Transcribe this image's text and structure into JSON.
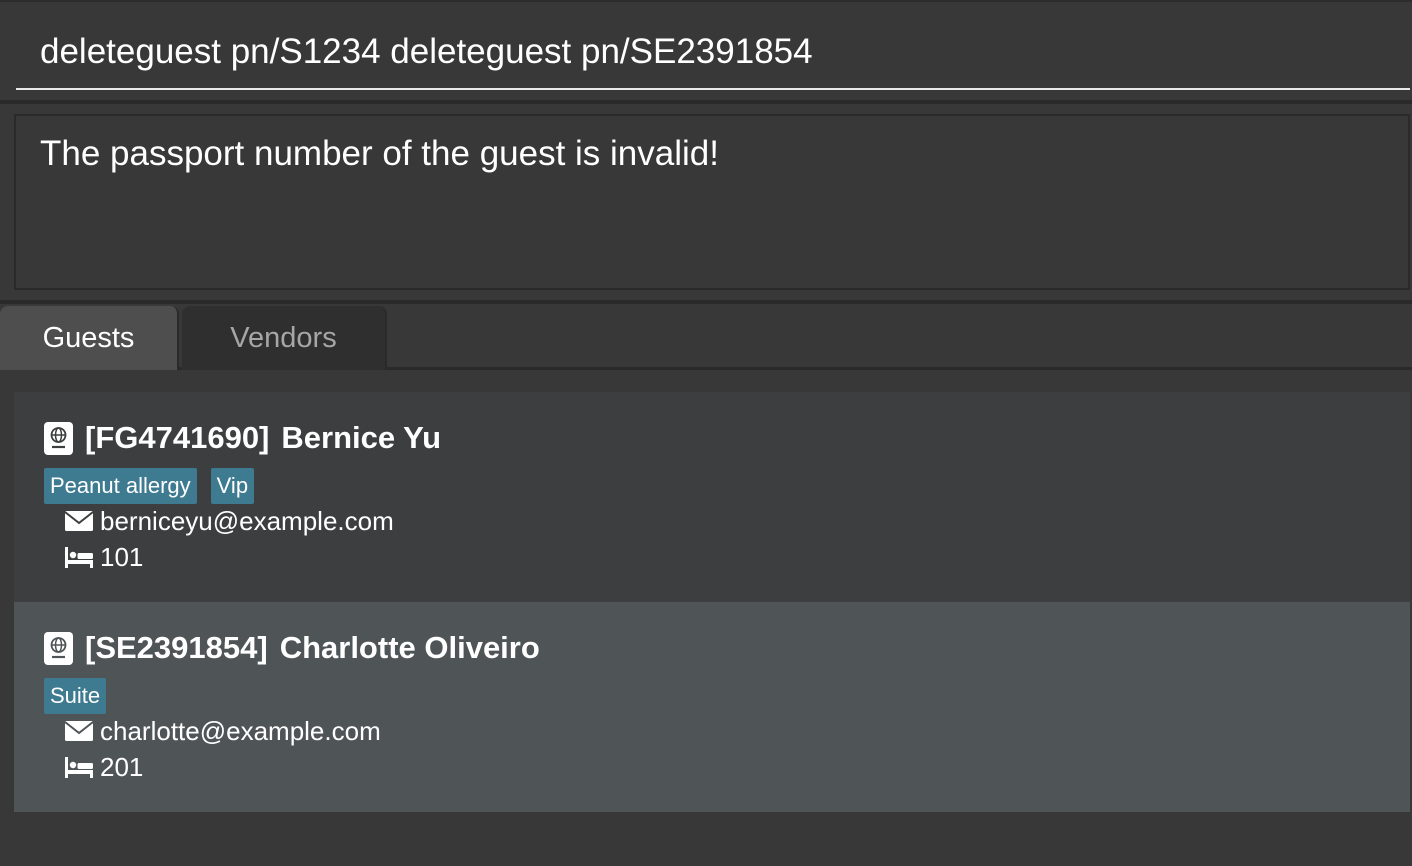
{
  "command": {
    "value": "deleteguest pn/S1234 deleteguest pn/SE2391854"
  },
  "result": {
    "message": "The passport number of the guest is invalid!"
  },
  "tabs": [
    {
      "label": "Guests",
      "active": true
    },
    {
      "label": "Vendors",
      "active": false
    }
  ],
  "guests": [
    {
      "passport": "[FG4741690]",
      "name": "Bernice Yu",
      "tags": [
        "Peanut allergy",
        "Vip"
      ],
      "email": "berniceyu@example.com",
      "room": "101",
      "selected": false
    },
    {
      "passport": "[SE2391854]",
      "name": "Charlotte Oliveiro",
      "tags": [
        "Suite"
      ],
      "email": "charlotte@example.com",
      "room": "201",
      "selected": true
    }
  ],
  "icons": {
    "passport": "passport-icon",
    "email": "envelope-icon",
    "room": "bed-icon"
  },
  "colors": {
    "background": "#383838",
    "tag": "#3e7b91",
    "selected_card": "#4f5557",
    "card": "#3c3e3f",
    "text": "#ffffff",
    "inactive_tab_text": "#a6a6a6"
  }
}
